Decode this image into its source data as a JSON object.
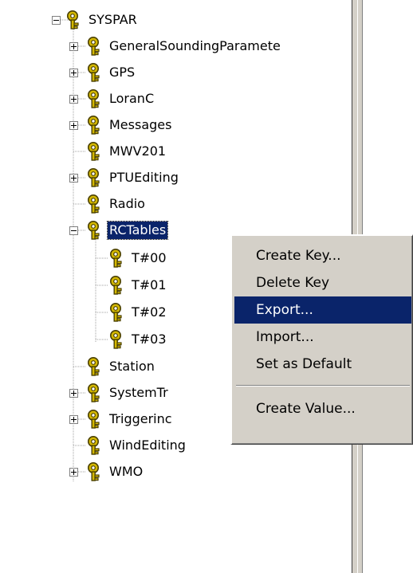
{
  "tree": {
    "root": {
      "label": "SYSPAR",
      "expander": "minus"
    },
    "items": [
      {
        "label": "GeneralSoundingParamete",
        "expander": "plus"
      },
      {
        "label": "GPS",
        "expander": "plus"
      },
      {
        "label": "LoranC",
        "expander": "plus"
      },
      {
        "label": "Messages",
        "expander": "plus"
      },
      {
        "label": "MWV201",
        "expander": "none"
      },
      {
        "label": "PTUEditing",
        "expander": "plus"
      },
      {
        "label": "Radio",
        "expander": "none"
      },
      {
        "label": "RCTables",
        "expander": "minus",
        "selected": true
      },
      {
        "label": "Station",
        "expander": "none"
      },
      {
        "label": "SystemTr",
        "expander": "plus"
      },
      {
        "label": "Triggerinc",
        "expander": "plus"
      },
      {
        "label": "WindEditing",
        "expander": "none"
      },
      {
        "label": "WMO",
        "expander": "plus"
      }
    ],
    "children": [
      {
        "label": "T#00"
      },
      {
        "label": "T#01"
      },
      {
        "label": "T#02"
      },
      {
        "label": "T#03"
      }
    ]
  },
  "context_menu": {
    "items": [
      {
        "label": "Create Key..."
      },
      {
        "label": "Delete Key"
      },
      {
        "label": "Export...",
        "highlighted": true
      },
      {
        "label": "Import..."
      },
      {
        "label": "Set as Default"
      },
      {
        "label": "Create Value..."
      }
    ]
  },
  "icons": {
    "key": "registry-key-icon"
  },
  "colors": {
    "selection": "#0a246a",
    "key_icon_fill": "#d4b800",
    "key_icon_outline": "#4a4000",
    "face": "#d4d0c8"
  }
}
